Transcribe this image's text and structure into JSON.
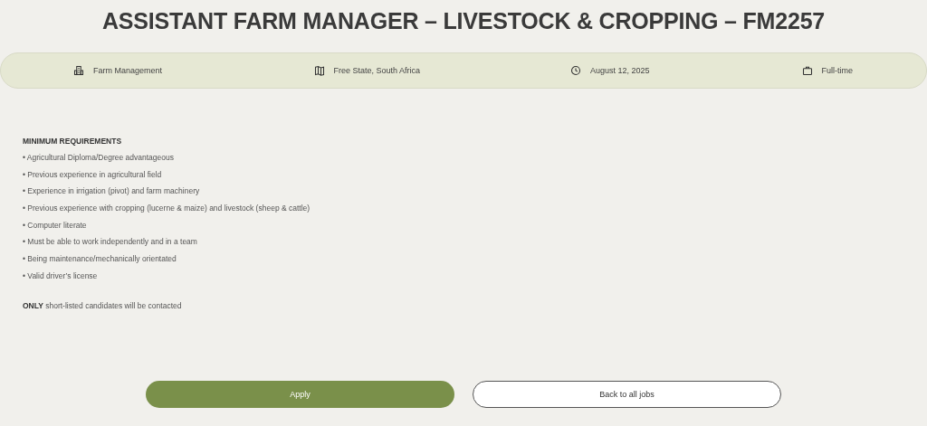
{
  "title": "ASSISTANT FARM MANAGER – LIVESTOCK & CROPPING – FM2257",
  "meta": [
    {
      "kind": "building",
      "text": "Farm Management"
    },
    {
      "kind": "map",
      "text": "Free State, South Africa"
    },
    {
      "kind": "clock",
      "text": "August 12, 2025"
    },
    {
      "kind": "briefcase",
      "text": "Full-time"
    }
  ],
  "section_heading": "MINIMUM REQUIREMENTS",
  "requirements": [
    "• Agricultural Diploma/Degree advantageous",
    "• Previous experience in agricultural field",
    "• Experience in irrigation (pivot) and farm machinery",
    "• Previous experience with cropping (lucerne & maize) and livestock (sheep & cattle)",
    "• Computer literate",
    "• Must be able to work independently and in a team",
    "• Being maintenance/mechanically orientated",
    "• Valid driver’s license"
  ],
  "note": "**ONLY** short-listed candidates will be contacted",
  "buttons": [
    {
      "kind": "primary",
      "label": "Apply"
    },
    {
      "kind": "secondary",
      "label": "Back to all jobs"
    }
  ]
}
